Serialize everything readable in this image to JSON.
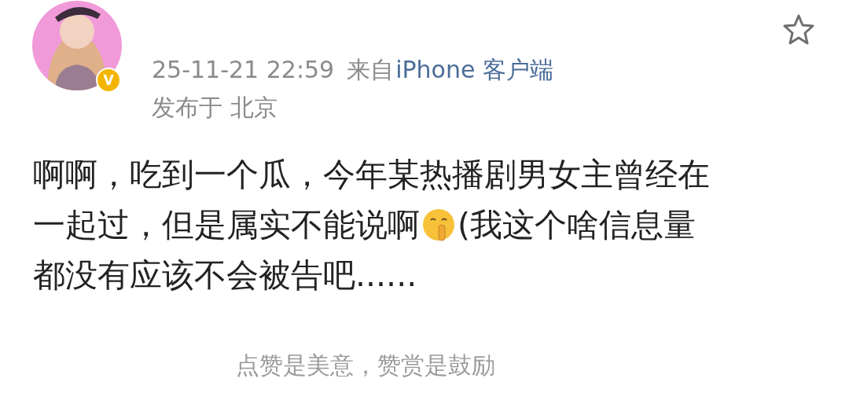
{
  "post": {
    "avatar": {
      "kind": "picture",
      "badge": "V"
    },
    "favorite": {
      "selected": false
    },
    "timestamp": "25-11-21 22:59",
    "source_prefix": "来自",
    "source": "iPhone 客户端",
    "location": "发布于 北京",
    "body_lines": [
      [
        {
          "kind": "text",
          "text": "啊啊，吃到一个瓜，今年某热播剧男女主曾经在"
        }
      ],
      [
        {
          "kind": "text",
          "text": "一起过，但是属实不能说啊"
        },
        {
          "kind": "emoji"
        },
        {
          "kind": "text",
          "text": "(我这个啥信息量"
        }
      ],
      [
        {
          "kind": "text",
          "text": "都没有应该不会被告吧......"
        }
      ]
    ]
  },
  "footer": "点赞是美意，赞赏是鼓励"
}
